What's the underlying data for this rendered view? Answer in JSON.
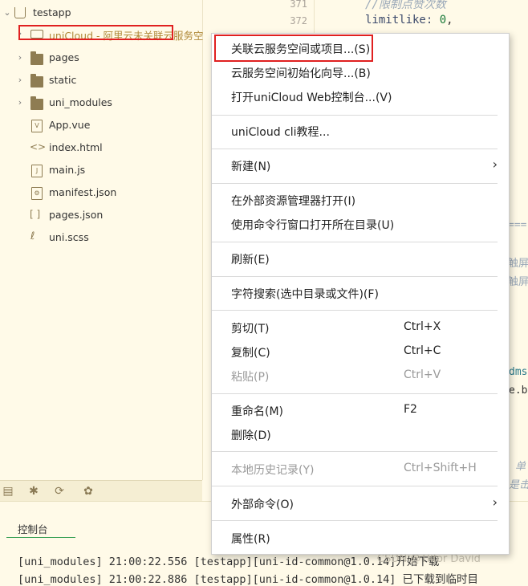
{
  "explorer": {
    "project": "testapp",
    "items": [
      {
        "label": "uniCloud - 阿里云未关联云服务空间",
        "icon": "cloud-folder-icon",
        "expand": true
      },
      {
        "label": "pages",
        "icon": "folder-icon",
        "expand": true
      },
      {
        "label": "static",
        "icon": "folder-icon",
        "expand": true
      },
      {
        "label": "uni_modules",
        "icon": "folder-icon",
        "expand": true
      },
      {
        "label": "App.vue",
        "icon": "vue-file-icon",
        "expand": false
      },
      {
        "label": "index.html",
        "icon": "html-file-icon",
        "expand": false
      },
      {
        "label": "main.js",
        "icon": "js-file-icon",
        "expand": false
      },
      {
        "label": "manifest.json",
        "icon": "manifest-file-icon",
        "expand": false
      },
      {
        "label": "pages.json",
        "icon": "json-file-icon",
        "expand": false
      },
      {
        "label": "uni.scss",
        "icon": "scss-file-icon",
        "expand": false
      }
    ]
  },
  "editor": {
    "lines": [
      "371",
      "372"
    ],
    "code_comment": "//限制点赞次数",
    "code_key": "limitlike: ",
    "code_num": "0",
    "code_punct": ",",
    "fragments": [
      "===",
      "触屏",
      "触屏",
      "dms",
      "e.ba",
      "单",
      "是击"
    ]
  },
  "menu": {
    "items": [
      {
        "label": "关联云服务空间或项目...(S)"
      },
      {
        "label": "云服务空间初始化向导...(B)"
      },
      {
        "label": "打开uniCloud Web控制台...(V)"
      },
      {
        "label": "uniCloud cli教程..."
      },
      {
        "label": "新建(N)",
        "submenu": true
      },
      {
        "label": "在外部资源管理器打开(I)"
      },
      {
        "label": "使用命令行窗口打开所在目录(U)"
      },
      {
        "label": "刷新(E)"
      },
      {
        "label": "字符搜索(选中目录或文件)(F)"
      },
      {
        "label": "剪切(T)",
        "shortcut": "Ctrl+X"
      },
      {
        "label": "复制(C)",
        "shortcut": "Ctrl+C"
      },
      {
        "label": "粘贴(P)",
        "shortcut": "Ctrl+V",
        "disabled": true
      },
      {
        "label": "重命名(M)",
        "shortcut": "F2"
      },
      {
        "label": "删除(D)"
      },
      {
        "label": "本地历史记录(Y)",
        "shortcut": "Ctrl+Shift+H",
        "disabled": true
      },
      {
        "label": "外部命令(O)",
        "submenu": true
      },
      {
        "label": "属性(R)"
      }
    ]
  },
  "console": {
    "tab": "控制台",
    "lines": [
      "[uni_modules] 21:00:22.556 [testapp][uni-id-common@1.0.14]开始下载",
      "[uni_modules] 21:00:22.886 [testapp][uni-id-common@1.0.14] 已下载到临时目"
    ]
  },
  "watermark": "CSDN @Tlifor David",
  "colors": {
    "highlight": "#e02020",
    "background": "#fffae8",
    "tab_underline": "#2e9b4d"
  }
}
